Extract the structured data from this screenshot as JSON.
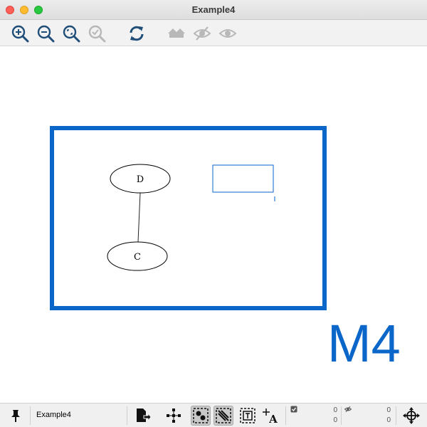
{
  "window": {
    "title": "Example4"
  },
  "toolbar": {
    "buttons": [
      {
        "name": "zoom-in",
        "icon": "zoom-in-icon",
        "enabled": true
      },
      {
        "name": "zoom-out",
        "icon": "zoom-out-icon",
        "enabled": true
      },
      {
        "name": "zoom-fit",
        "icon": "zoom-fit-icon",
        "enabled": true
      },
      {
        "name": "zoom-selected",
        "icon": "zoom-selected-icon",
        "enabled": false
      },
      {
        "name": "refresh",
        "icon": "refresh-icon",
        "enabled": true
      },
      {
        "name": "home",
        "icon": "home-icon",
        "enabled": false
      },
      {
        "name": "hide",
        "icon": "eye-slash-icon",
        "enabled": false
      },
      {
        "name": "show",
        "icon": "eye-icon",
        "enabled": false
      }
    ]
  },
  "canvas": {
    "nodes": [
      {
        "id": "D",
        "label": "D"
      },
      {
        "id": "C",
        "label": "C"
      }
    ],
    "edges": [
      {
        "source": "D",
        "target": "C"
      }
    ],
    "group_box_color": "#0a66c8",
    "annotation_label": "M4"
  },
  "statusbar": {
    "network_name": "Example4",
    "selected_nodes": "0",
    "selected_edges": "0",
    "hidden_nodes": "0",
    "hidden_edges": "0"
  },
  "colors": {
    "accent": "#0a66c8",
    "toolbar_icon": "#1f4e79",
    "disabled_icon": "#b8b8b8"
  }
}
